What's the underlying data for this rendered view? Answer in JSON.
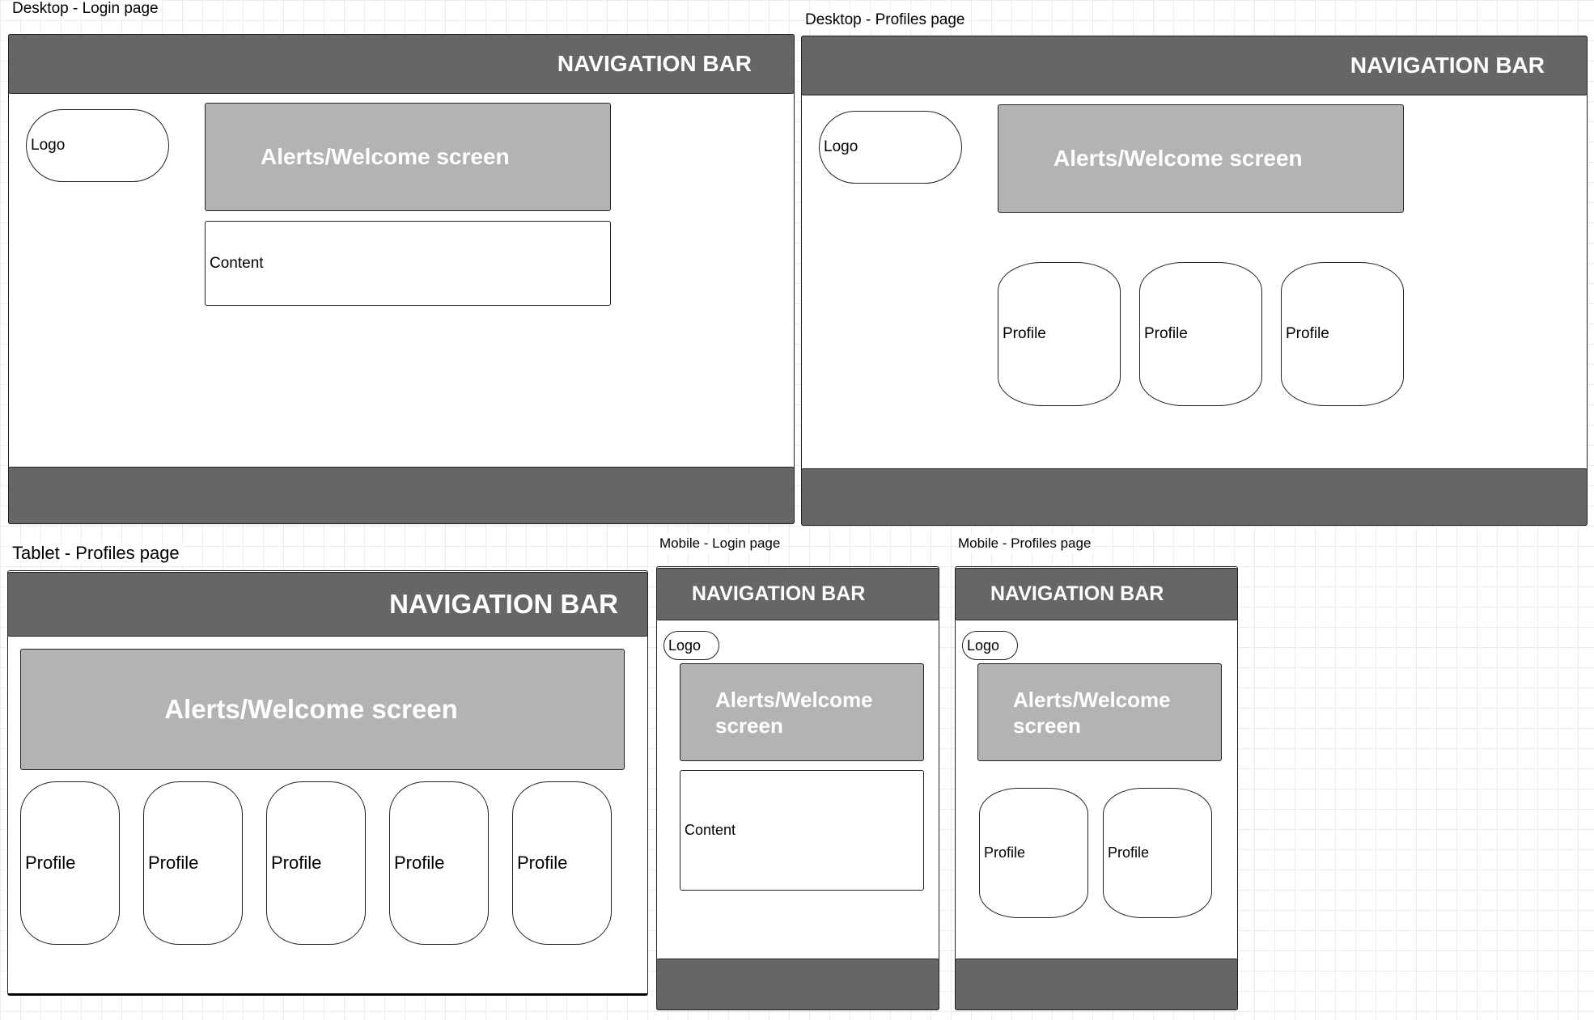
{
  "wireframes": {
    "desktop_login": {
      "title": "Desktop - Login page",
      "navbar": "NAVIGATION BAR",
      "logo": "Logo",
      "alerts": "Alerts/Welcome screen",
      "content": "Content"
    },
    "desktop_profiles": {
      "title": "Desktop - Profiles page",
      "navbar": "NAVIGATION BAR",
      "logo": "Logo",
      "alerts": "Alerts/Welcome screen",
      "profiles": [
        "Profile",
        "Profile",
        "Profile"
      ]
    },
    "tablet_profiles": {
      "title": "Tablet - Profiles page",
      "navbar": "NAVIGATION BAR",
      "alerts": "Alerts/Welcome screen",
      "profiles": [
        "Profile",
        "Profile",
        "Profile",
        "Profile",
        "Profile"
      ]
    },
    "mobile_login": {
      "title": "Mobile - Login page",
      "navbar": "NAVIGATION BAR",
      "logo": "Logo",
      "alerts": "Alerts/Welcome screen",
      "content": "Content"
    },
    "mobile_profiles": {
      "title": "Mobile - Profiles page",
      "navbar": "NAVIGATION BAR",
      "logo": "Logo",
      "alerts": "Alerts/Welcome screen",
      "profiles": [
        "Profile",
        "Profile"
      ]
    }
  },
  "colors": {
    "nav_footer": "#666666",
    "alerts": "#b3b3b3",
    "grid": "#ececec",
    "stroke": "#222222"
  }
}
